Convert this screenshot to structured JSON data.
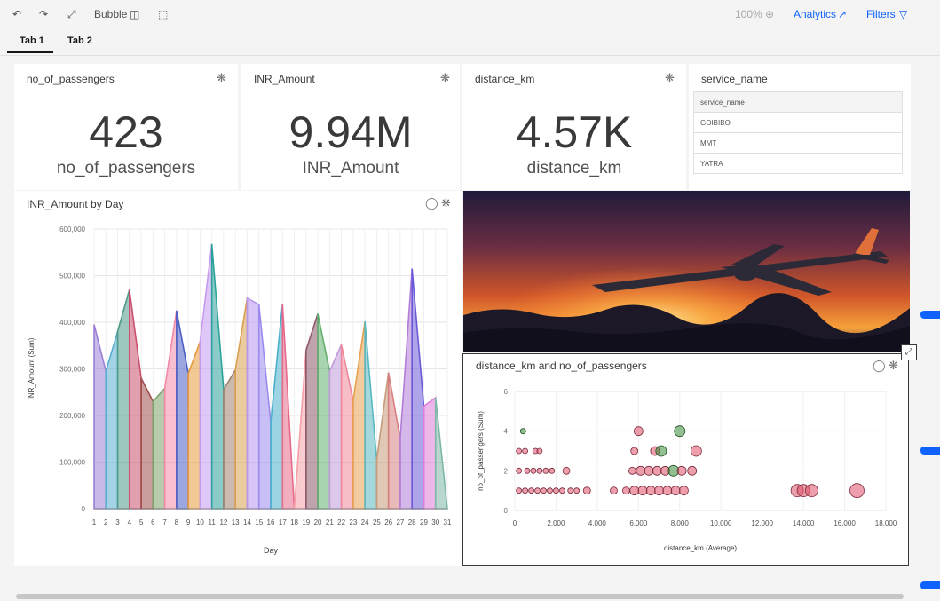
{
  "toolbar": {
    "viz_label": "Bubble",
    "zoom_label": "100%",
    "analytics_label": "Analytics",
    "filters_label": "Filters"
  },
  "tabs": [
    {
      "label": "Tab 1"
    },
    {
      "label": "Tab 2"
    }
  ],
  "kpis": [
    {
      "title": "no_of_passengers",
      "value": "423",
      "label": "no_of_passengers"
    },
    {
      "title": "INR_Amount",
      "value": "9.94M",
      "label": "INR_Amount"
    },
    {
      "title": "distance_km",
      "value": "4.57K",
      "label": "distance_km"
    }
  ],
  "service_list": {
    "title": "service_name",
    "header": "service_name",
    "rows": [
      "GOIBIBO",
      "MMT",
      "YATRA"
    ]
  },
  "colors": {
    "accent": "#0f62fe",
    "bubble_red": "#e0506a",
    "bubble_green": "#3a8c3a"
  },
  "area_chart": {
    "title": "INR_Amount by Day",
    "chart_data": {
      "type": "area",
      "x": [
        1,
        2,
        3,
        4,
        5,
        6,
        7,
        8,
        9,
        10,
        11,
        12,
        13,
        14,
        15,
        16,
        17,
        18,
        19,
        20,
        21,
        22,
        23,
        24,
        25,
        26,
        27,
        28,
        29,
        30,
        31
      ],
      "values": [
        395000,
        295000,
        380000,
        470000,
        280000,
        230000,
        258000,
        425000,
        290000,
        358000,
        568000,
        255000,
        298000,
        452000,
        438000,
        185000,
        440000,
        0,
        340000,
        418000,
        295000,
        352000,
        232000,
        402000,
        105000,
        292000,
        150000,
        515000,
        220000,
        238000,
        0
      ],
      "xlabel": "Day",
      "ylabel": "INR_Amount (Sum)",
      "ylim": [
        0,
        600000
      ],
      "yticks": [
        "0",
        "100,000",
        "200,000",
        "300,000",
        "400,000",
        "500,000",
        "600,000"
      ],
      "xticks": [
        "1",
        "2",
        "3",
        "4",
        "5",
        "6",
        "7",
        "8",
        "9",
        "10",
        "11",
        "12",
        "13",
        "14",
        "15",
        "16",
        "17",
        "18",
        "19",
        "20",
        "21",
        "22",
        "23",
        "24",
        "25",
        "26",
        "27",
        "28",
        "29",
        "30",
        "31"
      ],
      "grid": true,
      "series_colors": [
        "#9b7fd6",
        "#5aaed0",
        "#4f9b8a",
        "#c8506e",
        "#a04e4e",
        "#7ca06a",
        "#f28aa8",
        "#4d5fc4",
        "#e79b3e",
        "#c59bf0",
        "#2ca39a",
        "#a0826d",
        "#d8a050",
        "#b796f0",
        "#9c8aee",
        "#4ab0cc",
        "#e76a8a",
        "#f6a0a8",
        "#8c5a6a",
        "#62b070",
        "#c09ad8",
        "#f0889a",
        "#e8a050",
        "#5ab8c0",
        "#c79a7a",
        "#d88080",
        "#b27dd8",
        "#6a5ad8",
        "#e07cd8",
        "#7eb8a8"
      ]
    }
  },
  "image_panel": {
    "alt_title": "airplane-sunset-photo"
  },
  "bubble_chart": {
    "title": "distance_km and no_of_passengers",
    "chart_data": {
      "type": "scatter",
      "xlabel": "distance_km (Average)",
      "ylabel": "no_of_passengers (Sum)",
      "xlim": [
        0,
        18000
      ],
      "ylim": [
        0,
        6
      ],
      "xticks": [
        "0",
        "2,000",
        "4,000",
        "6,000",
        "8,000",
        "10,000",
        "12,000",
        "14,000",
        "16,000",
        "18,000"
      ],
      "yticks": [
        "0",
        "2",
        "4",
        "6"
      ],
      "grid": true,
      "points": [
        {
          "x": 400,
          "y": 4,
          "r": 3,
          "c": "g"
        },
        {
          "x": 6000,
          "y": 4,
          "r": 5,
          "c": "r"
        },
        {
          "x": 8000,
          "y": 4,
          "r": 6,
          "c": "g"
        },
        {
          "x": 200,
          "y": 3,
          "r": 3,
          "c": "r"
        },
        {
          "x": 500,
          "y": 3,
          "r": 3,
          "c": "r"
        },
        {
          "x": 1000,
          "y": 3,
          "r": 3,
          "c": "r"
        },
        {
          "x": 1200,
          "y": 3,
          "r": 3,
          "c": "r"
        },
        {
          "x": 5800,
          "y": 3,
          "r": 4,
          "c": "r"
        },
        {
          "x": 6800,
          "y": 3,
          "r": 5,
          "c": "r"
        },
        {
          "x": 7100,
          "y": 3,
          "r": 6,
          "c": "g"
        },
        {
          "x": 8800,
          "y": 3,
          "r": 6,
          "c": "r"
        },
        {
          "x": 200,
          "y": 2,
          "r": 3,
          "c": "r"
        },
        {
          "x": 600,
          "y": 2,
          "r": 3,
          "c": "r"
        },
        {
          "x": 900,
          "y": 2,
          "r": 3,
          "c": "r"
        },
        {
          "x": 1200,
          "y": 2,
          "r": 3,
          "c": "r"
        },
        {
          "x": 1500,
          "y": 2,
          "r": 3,
          "c": "r"
        },
        {
          "x": 1800,
          "y": 2,
          "r": 3,
          "c": "r"
        },
        {
          "x": 2500,
          "y": 2,
          "r": 4,
          "c": "r"
        },
        {
          "x": 5700,
          "y": 2,
          "r": 4,
          "c": "r"
        },
        {
          "x": 6100,
          "y": 2,
          "r": 5,
          "c": "r"
        },
        {
          "x": 6500,
          "y": 2,
          "r": 5,
          "c": "r"
        },
        {
          "x": 6900,
          "y": 2,
          "r": 5,
          "c": "r"
        },
        {
          "x": 7300,
          "y": 2,
          "r": 5,
          "c": "r"
        },
        {
          "x": 7700,
          "y": 2,
          "r": 6,
          "c": "g"
        },
        {
          "x": 8100,
          "y": 2,
          "r": 5,
          "c": "r"
        },
        {
          "x": 8600,
          "y": 2,
          "r": 5,
          "c": "r"
        },
        {
          "x": 200,
          "y": 1,
          "r": 3,
          "c": "r"
        },
        {
          "x": 500,
          "y": 1,
          "r": 3,
          "c": "r"
        },
        {
          "x": 800,
          "y": 1,
          "r": 3,
          "c": "r"
        },
        {
          "x": 1100,
          "y": 1,
          "r": 3,
          "c": "r"
        },
        {
          "x": 1400,
          "y": 1,
          "r": 3,
          "c": "r"
        },
        {
          "x": 1700,
          "y": 1,
          "r": 3,
          "c": "r"
        },
        {
          "x": 2000,
          "y": 1,
          "r": 3,
          "c": "r"
        },
        {
          "x": 2300,
          "y": 1,
          "r": 3,
          "c": "r"
        },
        {
          "x": 2700,
          "y": 1,
          "r": 3,
          "c": "r"
        },
        {
          "x": 3000,
          "y": 1,
          "r": 3,
          "c": "r"
        },
        {
          "x": 3500,
          "y": 1,
          "r": 4,
          "c": "r"
        },
        {
          "x": 4800,
          "y": 1,
          "r": 4,
          "c": "r"
        },
        {
          "x": 5400,
          "y": 1,
          "r": 4,
          "c": "r"
        },
        {
          "x": 5800,
          "y": 1,
          "r": 5,
          "c": "r"
        },
        {
          "x": 6200,
          "y": 1,
          "r": 5,
          "c": "r"
        },
        {
          "x": 6600,
          "y": 1,
          "r": 5,
          "c": "r"
        },
        {
          "x": 7000,
          "y": 1,
          "r": 5,
          "c": "r"
        },
        {
          "x": 7400,
          "y": 1,
          "r": 5,
          "c": "r"
        },
        {
          "x": 7800,
          "y": 1,
          "r": 5,
          "c": "r"
        },
        {
          "x": 8200,
          "y": 1,
          "r": 5,
          "c": "r"
        },
        {
          "x": 13700,
          "y": 1,
          "r": 7,
          "c": "r"
        },
        {
          "x": 14000,
          "y": 1,
          "r": 7,
          "c": "r"
        },
        {
          "x": 14400,
          "y": 1,
          "r": 7,
          "c": "r"
        },
        {
          "x": 16600,
          "y": 1,
          "r": 8,
          "c": "r"
        }
      ]
    }
  }
}
